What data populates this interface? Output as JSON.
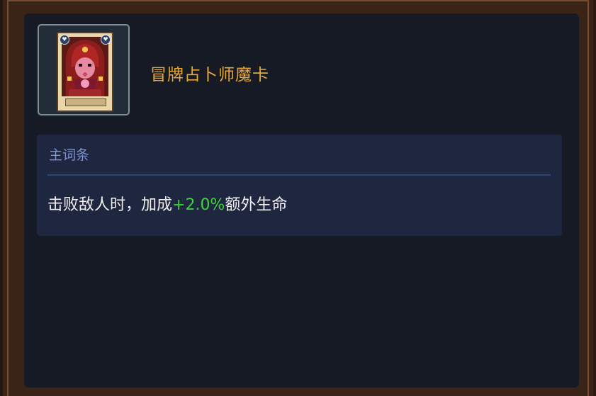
{
  "item": {
    "name": "冒牌占卜师魔卡",
    "card_corner_glyph": "♥",
    "name_color": "#e6a838"
  },
  "affix": {
    "header": "主词条",
    "text_before": "击败敌人时，加成",
    "value": "+2.0%",
    "text_after": "额外生命",
    "value_color": "#3ed13e"
  }
}
